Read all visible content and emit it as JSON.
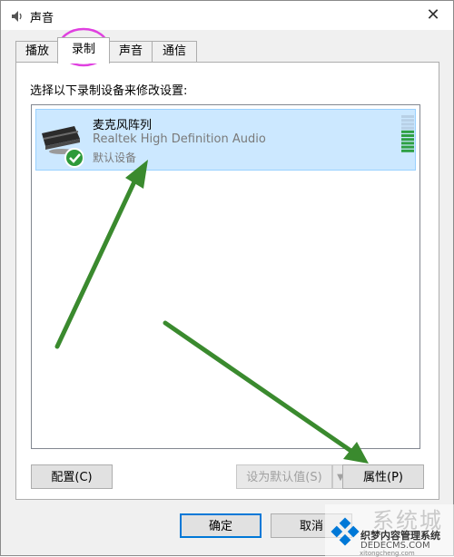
{
  "window": {
    "title": "声音",
    "close_glyph": "✕"
  },
  "tabs": [
    {
      "label": "播放"
    },
    {
      "label": "录制"
    },
    {
      "label": "声音"
    },
    {
      "label": "通信"
    }
  ],
  "panel": {
    "instruction": "选择以下录制设备来修改设置:"
  },
  "device": {
    "name": "麦克风阵列",
    "driver": "Realtek High Definition Audio",
    "status": "默认设备",
    "level": 0.55
  },
  "buttons": {
    "configure": "配置(C)",
    "set_default": "设为默认值(S)",
    "properties": "属性(P)",
    "ok": "确定",
    "cancel": "取消"
  },
  "watermark": {
    "line1": "织梦内容管理系统",
    "line2": "DEDECMS.COM",
    "faded": "系统城",
    "url_fragment": "xitongcheng.com"
  },
  "colors": {
    "selection": "#cce8ff",
    "accent": "#0078d7",
    "annotation_arrow": "#3a8a2e",
    "annotation_circle": "#e040e0"
  }
}
